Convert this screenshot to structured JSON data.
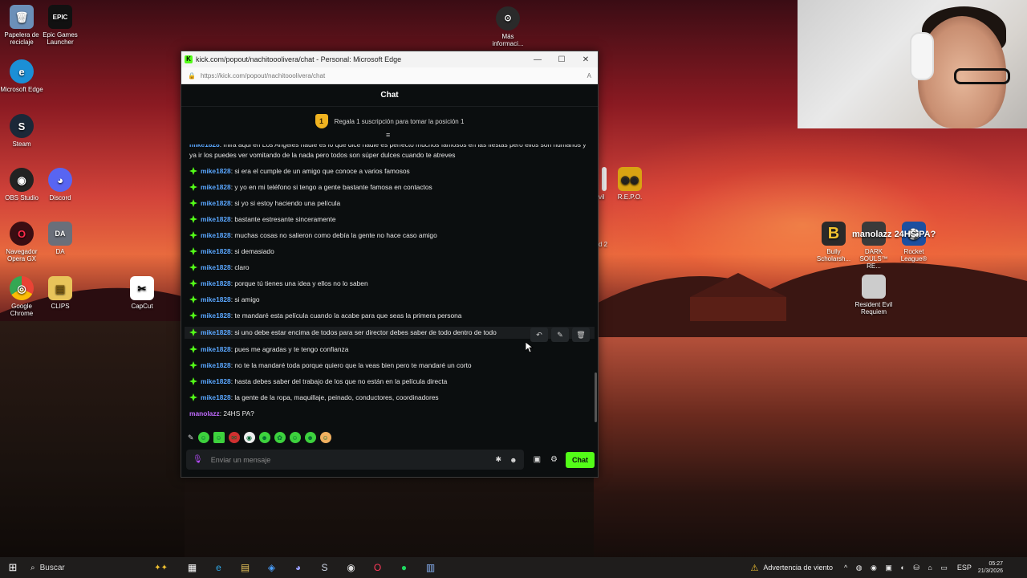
{
  "desktop": {
    "icons_left": [
      {
        "label": "Papelera de reciclaje",
        "glyph": "🗑"
      },
      {
        "label": "Epic Games Launcher",
        "glyph": "EPIC"
      },
      {
        "label": "Microsoft Edge",
        "glyph": "e"
      },
      {
        "label": "Steam",
        "glyph": "S"
      },
      {
        "label": "OBS Studio",
        "glyph": "◉"
      },
      {
        "label": "Discord",
        "glyph": "◕"
      },
      {
        "label": "Navegador Opera GX",
        "glyph": "O"
      },
      {
        "label": "DA",
        "glyph": "DA"
      },
      {
        "label": "Google Chrome",
        "glyph": "◎"
      },
      {
        "label": "CLIPS",
        "glyph": "▤"
      },
      {
        "label": "CapCut",
        "glyph": "✂"
      }
    ],
    "icon_more_info": "Más informaci...",
    "icon_repo": "R.E.P.O.",
    "icon_evil": "vil",
    "icon_d2": "d 2",
    "icons_right": [
      {
        "label": "Bully Scholarsh..."
      },
      {
        "label": "DARK SOULS™ RE..."
      },
      {
        "label": "Rocket League®"
      },
      {
        "label": "Resident Evil Requiem"
      }
    ],
    "overlay_text": "manolazz 24HS PA?"
  },
  "window": {
    "title": "kick.com/popout/nachitooolivera/chat - Personal: Microsoft Edge",
    "url": "https://kick.com/popout/nachitooolivera/chat",
    "chat_header": "Chat",
    "sub_banner": {
      "rank": "1",
      "text": "Regala 1 suscripción para tomar la posición 1"
    }
  },
  "chat": {
    "first_message": {
      "user": "mike1828",
      "text": ": mira aqui en Los Angeles nadie es lo que dice nadie es perfecto muchos famosos en las fiestas pero ellos son humanos y ya ir los puedes ver vomitando de la nada pero todos son súper dulces cuando te atreves"
    },
    "messages": [
      {
        "user": "mike1828",
        "text": ": si era el cumple de un amigo que conoce a varios famosos"
      },
      {
        "user": "mike1828",
        "text": ": y yo en mi teléfono si tengo a gente bastante famosa en contactos"
      },
      {
        "user": "mike1828",
        "text": ": si yo si estoy haciendo una película"
      },
      {
        "user": "mike1828",
        "text": ": bastante estresante sinceramente"
      },
      {
        "user": "mike1828",
        "text": ": muchas cosas no salieron como debía la gente no hace caso amigo"
      },
      {
        "user": "mike1828",
        "text": ": si demasiado"
      },
      {
        "user": "mike1828",
        "text": ": claro"
      },
      {
        "user": "mike1828",
        "text": ": porque tú tienes una idea y ellos no lo saben"
      },
      {
        "user": "mike1828",
        "text": ": si amigo"
      },
      {
        "user": "mike1828",
        "text": ": te mandaré esta película cuando la acabe para que seas la primera persona"
      },
      {
        "user": "mike1828",
        "text": ": si uno debe estar encima de todos para ser director debes saber de todo dentro de todo"
      },
      {
        "user": "mike1828",
        "text": ": pues me agradas y te tengo confianza"
      },
      {
        "user": "mike1828",
        "text": ": no te la mandaré toda porque quiero que la veas bien pero te mandaré un corto"
      },
      {
        "user": "mike1828",
        "text": ": hasta debes saber del trabajo de los que no están en la película directa"
      },
      {
        "user": "mike1828",
        "text": ": la gente de la ropa, maquillaje, peinado, conductores, coordinadores"
      }
    ],
    "last_message": {
      "user": "manolazz",
      "text": ": 24HS PA?"
    },
    "input_placeholder": "Enviar un mensaje",
    "send_label": "Chat"
  },
  "taskbar": {
    "search_label": "Buscar",
    "weather": "Advertencia de viento",
    "lang": "ESP",
    "time": "05:27",
    "date": "21/3/2026"
  },
  "colors": {
    "kick_green": "#53fc18",
    "username_blue": "#5aa7ff",
    "username_purple": "#c16bff"
  }
}
